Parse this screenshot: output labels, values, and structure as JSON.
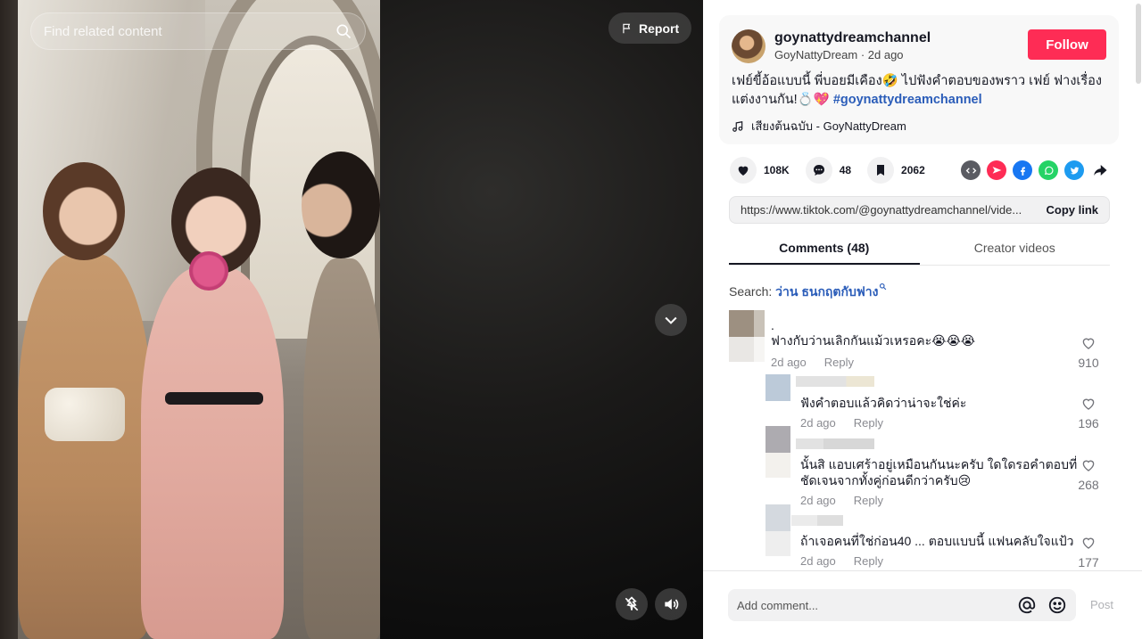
{
  "video": {
    "search_placeholder": "Find related content",
    "report_label": "Report"
  },
  "post": {
    "username": "goynattydreamchannel",
    "display_name": "GoyNattyDream",
    "time_ago": "2d ago",
    "follow_label": "Follow",
    "description": "เฟย์ขี้อ้อแบบนี้ พี่บอยมีเคือง🤣 ไปฟังคำตอบของพราว เฟย์ ฟางเรื่องแต่งงานกัน!💍💖 ",
    "hashtag": "#goynattydreamchannel",
    "music": "เสียงต้นฉบับ - GoyNattyDream"
  },
  "actions": {
    "likes": "108K",
    "comments": "48",
    "saves": "2062"
  },
  "share": {
    "link": "https://www.tiktok.com/@goynattydreamchannel/vide...",
    "copy_label": "Copy link"
  },
  "tabs": [
    {
      "label": "Comments (48)",
      "active": true
    },
    {
      "label": "Creator videos",
      "active": false
    }
  ],
  "search_suggestion": {
    "prefix": "Search:",
    "term": "ว่าน ธนกฤตกับฟาง"
  },
  "comments": [
    {
      "text_line1": ".",
      "text": "ฟางกับว่านเลิกกันแม้วเหรอคะ😭😭😭",
      "time": "2d ago",
      "reply": "Reply",
      "likes": "910"
    },
    {
      "text": "ฟังคำตอบแล้วคิดว่าน่าจะใช่ค่ะ",
      "time": "2d ago",
      "reply": "Reply",
      "likes": "196"
    },
    {
      "text": "นั้นสิ แอบเศร้าอยู่เหมือนกันนะครับ ใดใดรอคำตอบที่ชัดเจนจากทั้งคู่ก่อนดีกว่าครับ😢",
      "time": "2d ago",
      "reply": "Reply",
      "likes": "268"
    },
    {
      "text": "ถ้าเจอคนที่ใช่ก่อน40 ... ตอบแบบนี้ แฟนคลับใจแป้ว",
      "time": "2d ago",
      "reply": "Reply",
      "likes": "177"
    }
  ],
  "composer": {
    "placeholder": "Add comment...",
    "post_label": "Post"
  }
}
